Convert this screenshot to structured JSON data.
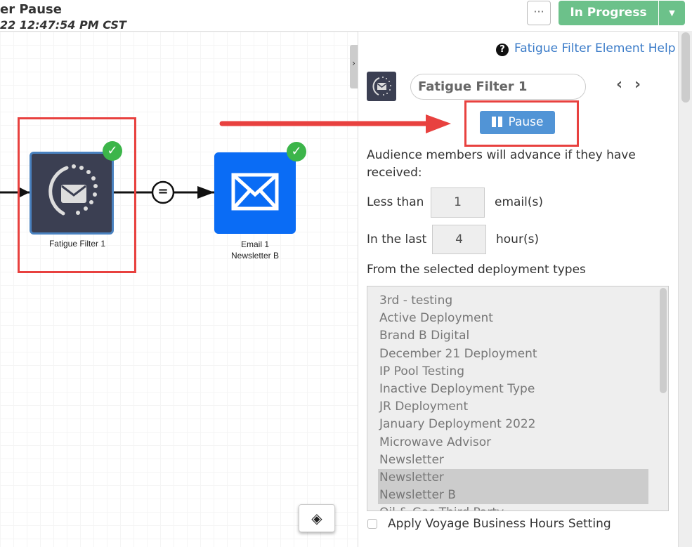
{
  "header": {
    "title": "er Pause",
    "subtitle": "22 12:47:54 PM CST",
    "more_label": "···",
    "status_label": "In Progress",
    "status_color": "#6cc18a"
  },
  "canvas": {
    "nodes": [
      {
        "label": "Fatigue Filter 1",
        "icon": "fatigue-filter-icon",
        "status": "check-icon"
      },
      {
        "label_line1": "Email 1",
        "label_line2": "Newsletter B",
        "icon": "envelope-icon",
        "status": "check-icon"
      }
    ],
    "connector_symbol": "="
  },
  "panel": {
    "help_link": "Fatigue Filter Element Help",
    "element_name": "Fatigue Filter 1",
    "pause_label": "Pause",
    "description": "Audience members will advance if they have received:",
    "less_than_label": "Less than",
    "less_than_value": "1",
    "less_than_unit": "email(s)",
    "in_last_label": "In the last",
    "in_last_value": "4",
    "in_last_unit": "hour(s)",
    "deployment_types_label": "From the selected deployment types",
    "deployment_types": [
      "3rd - testing",
      "Active Deployment",
      "Brand B Digital",
      "December 21 Deployment",
      "IP Pool Testing",
      "Inactive Deployment Type",
      "JR Deployment",
      "January Deployment 2022",
      "Microwave Advisor",
      "Newsletter",
      "Newsletter",
      "Newsletter B",
      "Oil & Gas Third Party"
    ],
    "selected": [
      10,
      11
    ],
    "business_hours_label": "Apply Voyage Business Hours Setting",
    "business_hours_checked": false
  }
}
